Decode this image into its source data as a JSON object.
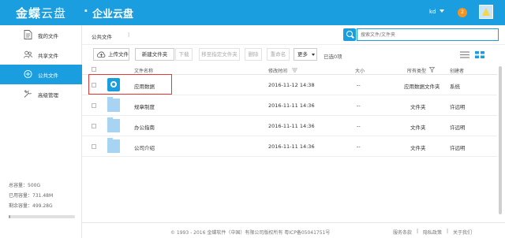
{
  "header": {
    "brand": "金蝶",
    "brand_thin": "云盘",
    "separator": "·",
    "product": "企业云盘",
    "user": "kd",
    "notifications": "2"
  },
  "sidebar": {
    "items": [
      {
        "label": "我的文件",
        "icon": "document-icon"
      },
      {
        "label": "共享文件",
        "icon": "users-icon"
      },
      {
        "label": "公共文件",
        "icon": "public-icon"
      },
      {
        "label": "高级管理",
        "icon": "tools-icon"
      }
    ],
    "active": 2,
    "quota_total": "总容量：500G",
    "quota_used": "已用容量：731.48M",
    "quota_free": "剩余容量：499.28G",
    "used_fraction": 0.0014
  },
  "breadcrumb": {
    "path": "公共文件",
    "divider": "|"
  },
  "search": {
    "placeholder": "搜索文件/文件夹"
  },
  "toolbar": {
    "upload": "上传文件",
    "new_folder": "新建文件夹",
    "download": "下载",
    "move": "移至指定文件夹",
    "delete": "删除",
    "rename": "重命名",
    "more": "更多",
    "selected": "已选0项"
  },
  "table": {
    "headers": {
      "name": "文件名称",
      "modified": "修改时间",
      "size": "大小",
      "type": "所有类型",
      "owner": "创建者"
    },
    "rows": [
      {
        "name": "应用数据",
        "modified": "2016-11-12 14:38",
        "size": "--",
        "type": "应用数据文件夹",
        "owner": "系统"
      },
      {
        "name": "规章制度",
        "modified": "2016-11-11 14:36",
        "size": "--",
        "type": "文件夹",
        "owner": "许远明"
      },
      {
        "name": "办公指南",
        "modified": "2016-11-11 14:36",
        "size": "--",
        "type": "文件夹",
        "owner": "许远明"
      },
      {
        "name": "公司介绍",
        "modified": "2016-11-11 14:36",
        "size": "--",
        "type": "文件夹",
        "owner": "许远明"
      }
    ]
  },
  "footer": {
    "copyright": "© 1993 - 2016 金蝶软件（中国）有限公司版权所有 粤ICP备05041751号",
    "terms": "服务条款",
    "privacy": "隐私政策",
    "about": "关于我们",
    "sep": "|"
  },
  "colors": {
    "primary": "#1a9ee0",
    "highlight_box": "#e53935",
    "badge": "#f39422"
  }
}
